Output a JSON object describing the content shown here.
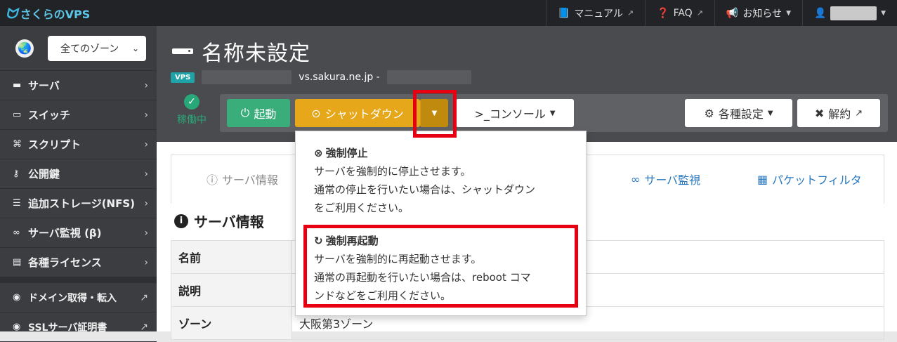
{
  "brand": {
    "name": "さくらのVPS"
  },
  "topnav": {
    "manual": "マニュアル",
    "faq": "FAQ",
    "news": "お知らせ"
  },
  "sidebar": {
    "zone_select": "全てのゾーン",
    "items": [
      {
        "label": "サーバ",
        "icon": "server-icon"
      },
      {
        "label": "スイッチ",
        "icon": "switch-icon"
      },
      {
        "label": "スクリプト",
        "icon": "script-icon"
      },
      {
        "label": "公開鍵",
        "icon": "key-icon"
      },
      {
        "label": "追加ストレージ(NFS)",
        "icon": "storage-icon"
      },
      {
        "label": "サーバ監視 (β)",
        "icon": "binoculars-icon"
      },
      {
        "label": "各種ライセンス",
        "icon": "license-icon"
      }
    ],
    "external": [
      {
        "label": "ドメイン取得・転入"
      },
      {
        "label": "SSLサーバ証明書"
      }
    ]
  },
  "server": {
    "title": "名称未設定",
    "badge": "VPS",
    "host": "vs.sakura.ne.jp -",
    "status": "稼働中"
  },
  "toolbar": {
    "start": "起動",
    "shutdown": "シャットダウン",
    "console": ">_コンソール",
    "settings": "各種設定",
    "cancel": "解約"
  },
  "tabs": {
    "info": "サーバ情報",
    "monitor": "サーバ監視",
    "packet": "パケットフィルタ"
  },
  "section": {
    "title": "サーバ情報"
  },
  "table": {
    "rows": [
      {
        "key": "名前",
        "value": ""
      },
      {
        "key": "説明",
        "value": ""
      },
      {
        "key": "ゾーン",
        "value": "大阪第3ゾーン"
      }
    ]
  },
  "dropdown": {
    "force_stop": {
      "title": "強制停止",
      "line1": "サーバを強制的に停止させます。",
      "line2": "通常の停止を行いたい場合は、シャットダウン",
      "line3": "をご利用ください。"
    },
    "force_restart": {
      "title": "強制再起動",
      "line1": "サーバを強制的に再起動させます。",
      "line2": "通常の再起動を行いたい場合は、reboot コマ",
      "line3": "ンドなどをご利用ください。"
    }
  },
  "colors": {
    "highlight": "#e60012",
    "start": "#3aae7a",
    "shutdown": "#e6a81a",
    "link": "#2a79c0"
  }
}
